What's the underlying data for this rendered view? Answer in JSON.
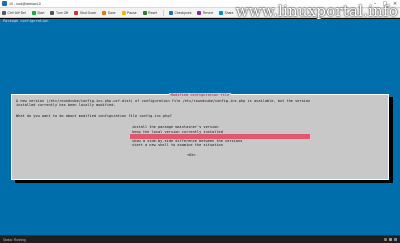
{
  "window": {
    "title": "10 - root@debian10",
    "controls": {
      "minimize": "–",
      "maximize": "□",
      "close": "×"
    }
  },
  "toolbar": {
    "items": [
      {
        "label": "Ctrl+Alt+Del",
        "icon": "keyboard-icon",
        "color": "#5a5a5a"
      },
      {
        "label": "Start",
        "icon": "start-icon",
        "color": "#1fa64a"
      },
      {
        "label": "Turn Off",
        "icon": "turn-off-icon",
        "color": "#555555"
      },
      {
        "label": "Shut Down",
        "icon": "shutdown-icon",
        "color": "#d32f2f"
      },
      {
        "label": "Save",
        "icon": "save-icon",
        "color": "#e07b00"
      },
      {
        "label": "Pause",
        "icon": "pause-icon",
        "color": "#f2b600"
      },
      {
        "label": "Reset",
        "icon": "reset-icon",
        "color": "#2e7d32"
      },
      {
        "label": "Checkpoint",
        "icon": "checkpoint-icon",
        "color": "#1b6fb5"
      },
      {
        "label": "Revert",
        "icon": "revert-icon",
        "color": "#8e24aa"
      },
      {
        "label": "Share",
        "icon": "share-icon",
        "color": "#0288d1"
      }
    ]
  },
  "watermark": "www.linuxportal.info",
  "console": {
    "title": "Package configuration"
  },
  "dialog": {
    "title": "Modified configuration file",
    "message_lines": [
      "A new version (/etc/roundcube/config.inc.php.ucf-dist) of configuration file /etc/roundcube/config.inc.php is available, but the version",
      "installed currently has been locally modified."
    ],
    "question": "What do you want to do about modified configuration file config.inc.php?",
    "options": [
      "install the package maintainer's version",
      "keep the local version currently installed",
      "show the differences between the versions",
      "show a side-by-side difference between the versions",
      "start a new shell to examine the situation"
    ],
    "selected_index": 2,
    "ok_label": "<Ok>"
  },
  "statusbar": {
    "text": "Status: Running"
  },
  "colors": {
    "console_bg": "#006eaa",
    "dialog_bg": "#c8c8c8",
    "selected_bg": "#e8546a",
    "title_red": "#b71c1c"
  }
}
